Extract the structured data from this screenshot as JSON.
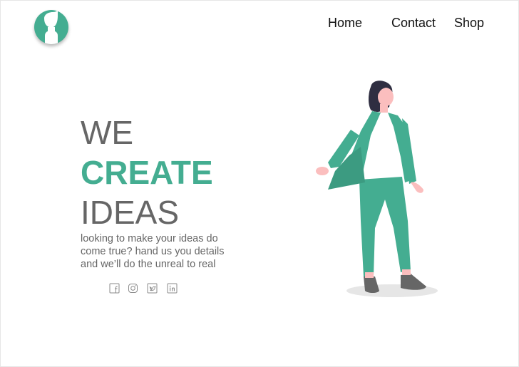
{
  "header": {
    "logo": {
      "icon": "person-avatar-icon",
      "color": "#44ad91"
    },
    "nav": [
      {
        "label": "Home"
      },
      {
        "label": "Contact"
      },
      {
        "label": "Shop"
      }
    ]
  },
  "hero": {
    "line1": "WE",
    "line2": "CREATE",
    "line3": "IDEAS",
    "description": [
      "looking to make your ideas do",
      "come true? hand us you details",
      "and we’ll do the unreal to real"
    ],
    "accent_color": "#44ad91",
    "text_color": "#666666"
  },
  "social": [
    {
      "icon": "facebook-icon"
    },
    {
      "icon": "instagram-icon"
    },
    {
      "icon": "twitter-icon"
    },
    {
      "icon": "linkedin-icon"
    }
  ],
  "illustration": {
    "subject": "standing-woman-illustration",
    "color": "#44ad91"
  }
}
